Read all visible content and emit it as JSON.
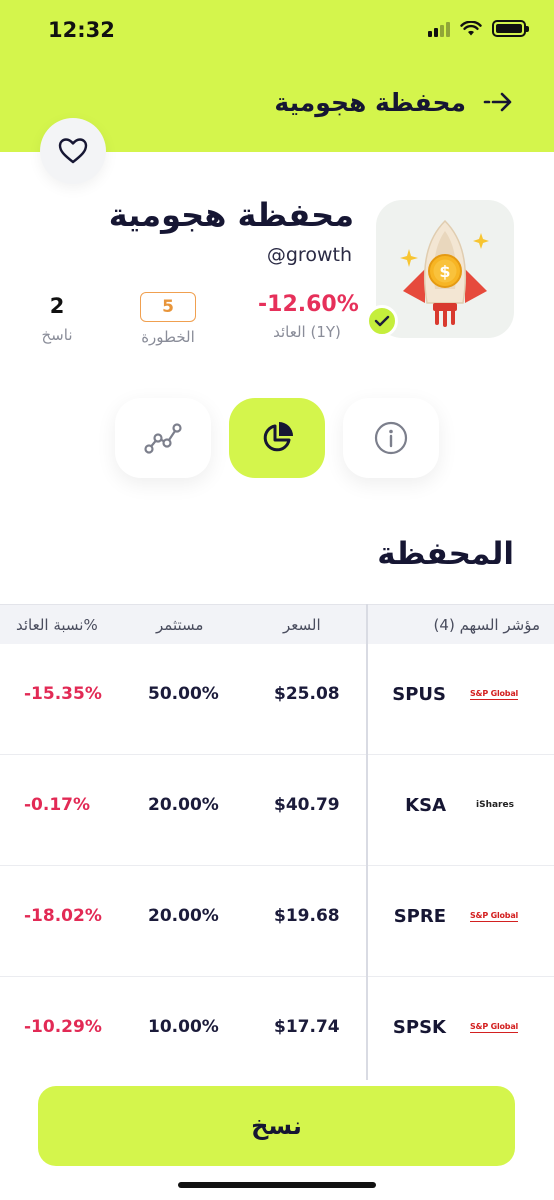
{
  "status_bar": {
    "time": "12:32"
  },
  "header": {
    "title": "محفظة هجومية"
  },
  "profile": {
    "name": "محفظة هجومية",
    "handle": "@growth"
  },
  "stats": {
    "return_value": "-12.60%",
    "return_label": "العائد (1Y)",
    "risk_value": "5",
    "risk_label": "الخطورة",
    "copiers_value": "2",
    "copiers_label": "ناسخ"
  },
  "tabs": [
    "performance-chart",
    "allocation-pie",
    "info"
  ],
  "section": {
    "title": "المحفظة"
  },
  "table": {
    "headers": {
      "ticker": "مؤشر السهم (4)",
      "price": "السعر",
      "invested": "مستثمر",
      "return": "نسبة العائد%"
    },
    "rows": [
      {
        "logo": "S&P Global",
        "ticker": "SPUS",
        "price": "$25.08",
        "invested": "50.00%",
        "return": "-15.35%"
      },
      {
        "logo": "iShares",
        "ticker": "KSA",
        "price": "$40.79",
        "invested": "20.00%",
        "return": "-0.17%"
      },
      {
        "logo": "S&P Global",
        "ticker": "SPRE",
        "price": "$19.68",
        "invested": "20.00%",
        "return": "-18.02%"
      },
      {
        "logo": "S&P Global",
        "ticker": "SPSK",
        "price": "$17.74",
        "invested": "10.00%",
        "return": "-10.29%"
      }
    ]
  },
  "cta": {
    "label": "نسخ"
  },
  "colors": {
    "accent": "#d4f54c",
    "negative": "#e22a55",
    "risk": "#e8953a"
  }
}
